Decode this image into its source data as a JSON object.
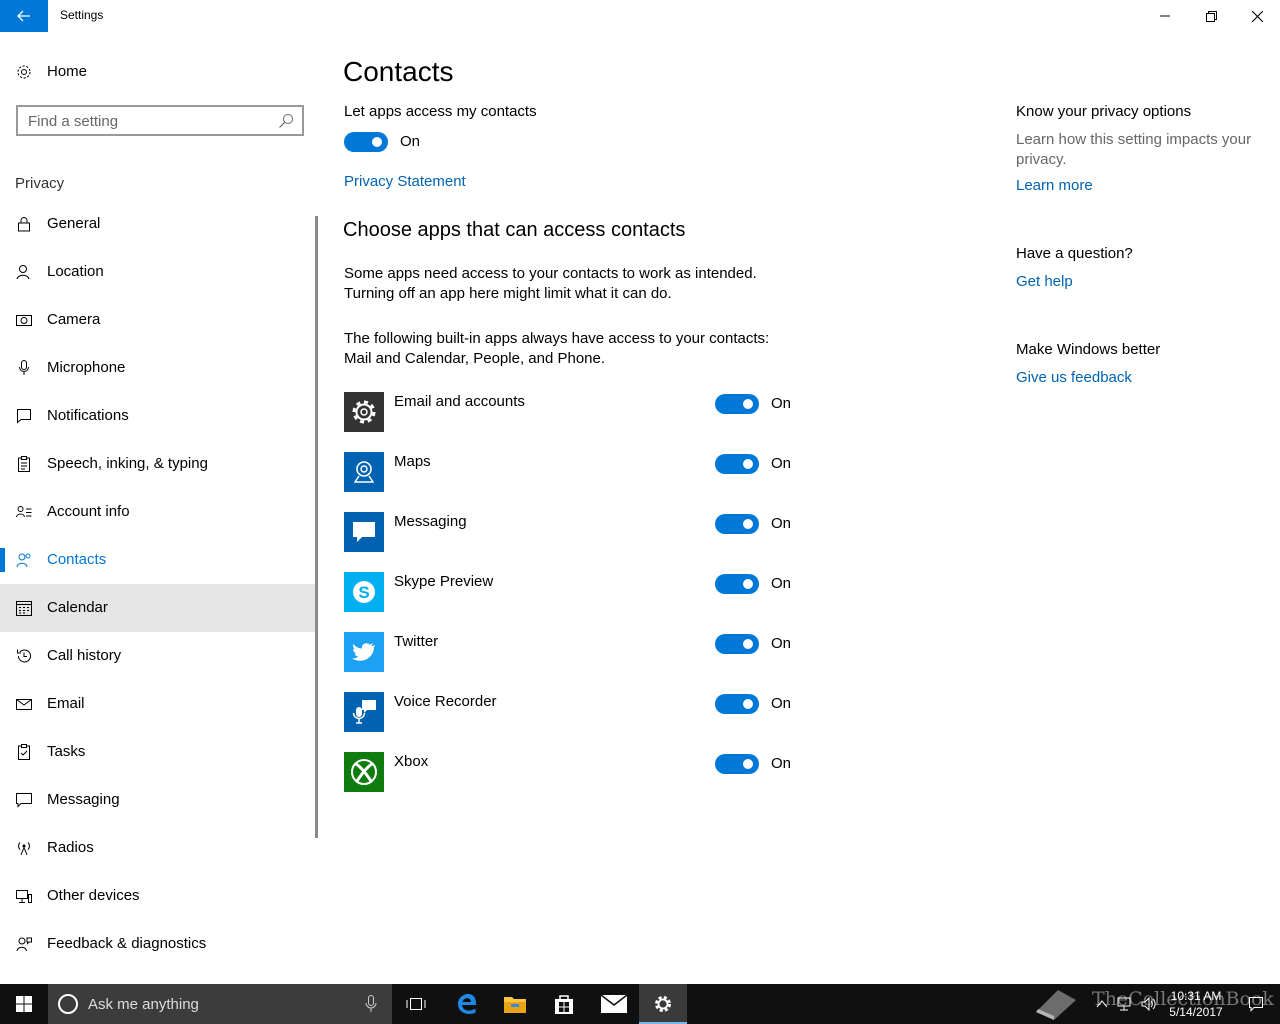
{
  "window": {
    "title": "Settings"
  },
  "sidebar": {
    "home_label": "Home",
    "search_placeholder": "Find a setting",
    "section_label": "Privacy",
    "items": [
      {
        "label": "General",
        "icon": "lock-icon"
      },
      {
        "label": "Location",
        "icon": "location-person-icon"
      },
      {
        "label": "Camera",
        "icon": "camera-icon"
      },
      {
        "label": "Microphone",
        "icon": "microphone-icon"
      },
      {
        "label": "Notifications",
        "icon": "notification-icon"
      },
      {
        "label": "Speech, inking, & typing",
        "icon": "clipboard-icon"
      },
      {
        "label": "Account info",
        "icon": "account-info-icon"
      },
      {
        "label": "Contacts",
        "icon": "contacts-icon",
        "active": true
      },
      {
        "label": "Calendar",
        "icon": "calendar-icon",
        "hover": true
      },
      {
        "label": "Call history",
        "icon": "history-icon"
      },
      {
        "label": "Email",
        "icon": "mail-icon"
      },
      {
        "label": "Tasks",
        "icon": "tasks-icon"
      },
      {
        "label": "Messaging",
        "icon": "message-icon"
      },
      {
        "label": "Radios",
        "icon": "radio-tower-icon"
      },
      {
        "label": "Other devices",
        "icon": "devices-icon"
      },
      {
        "label": "Feedback & diagnostics",
        "icon": "feedback-icon"
      }
    ]
  },
  "main": {
    "title": "Contacts",
    "master_toggle_label": "Let apps access my contacts",
    "master_toggle_state": "On",
    "privacy_link": "Privacy Statement",
    "apps_heading": "Choose apps that can access contacts",
    "desc_1": "Some apps need access to your contacts to work as intended. Turning off an app here might limit what it can do.",
    "desc_2": "The following built-in apps always have access to your contacts: Mail and Calendar, People, and Phone.",
    "apps": [
      {
        "name": "Email and accounts",
        "state": "On",
        "icon": "gear-icon",
        "tile_color": "#333333"
      },
      {
        "name": "Maps",
        "state": "On",
        "icon": "maps-icon",
        "tile_color": "#0063b1"
      },
      {
        "name": "Messaging",
        "state": "On",
        "icon": "message-bubble-icon",
        "tile_color": "#0063b1"
      },
      {
        "name": "Skype Preview",
        "state": "On",
        "icon": "skype-icon",
        "tile_color": "#00aff0"
      },
      {
        "name": "Twitter",
        "state": "On",
        "icon": "twitter-bird-icon",
        "tile_color": "#1da1f2"
      },
      {
        "name": "Voice Recorder",
        "state": "On",
        "icon": "voice-recorder-icon",
        "tile_color": "#0063b1"
      },
      {
        "name": "Xbox",
        "state": "On",
        "icon": "xbox-icon",
        "tile_color": "#107c10"
      }
    ]
  },
  "aside": {
    "privacy_heading": "Know your privacy options",
    "privacy_text": "Learn how this setting impacts your privacy.",
    "learn_more": "Learn more",
    "question_heading": "Have a question?",
    "get_help": "Get help",
    "better_heading": "Make Windows better",
    "feedback_link": "Give us feedback"
  },
  "taskbar": {
    "search_text": "Ask me anything",
    "time": "10:31 AM",
    "date": "5/14/2017",
    "watermark": "TheCollectionBook"
  },
  "colors": {
    "accent": "#0078d7",
    "link": "#0063b1",
    "taskbar": "#101010"
  }
}
